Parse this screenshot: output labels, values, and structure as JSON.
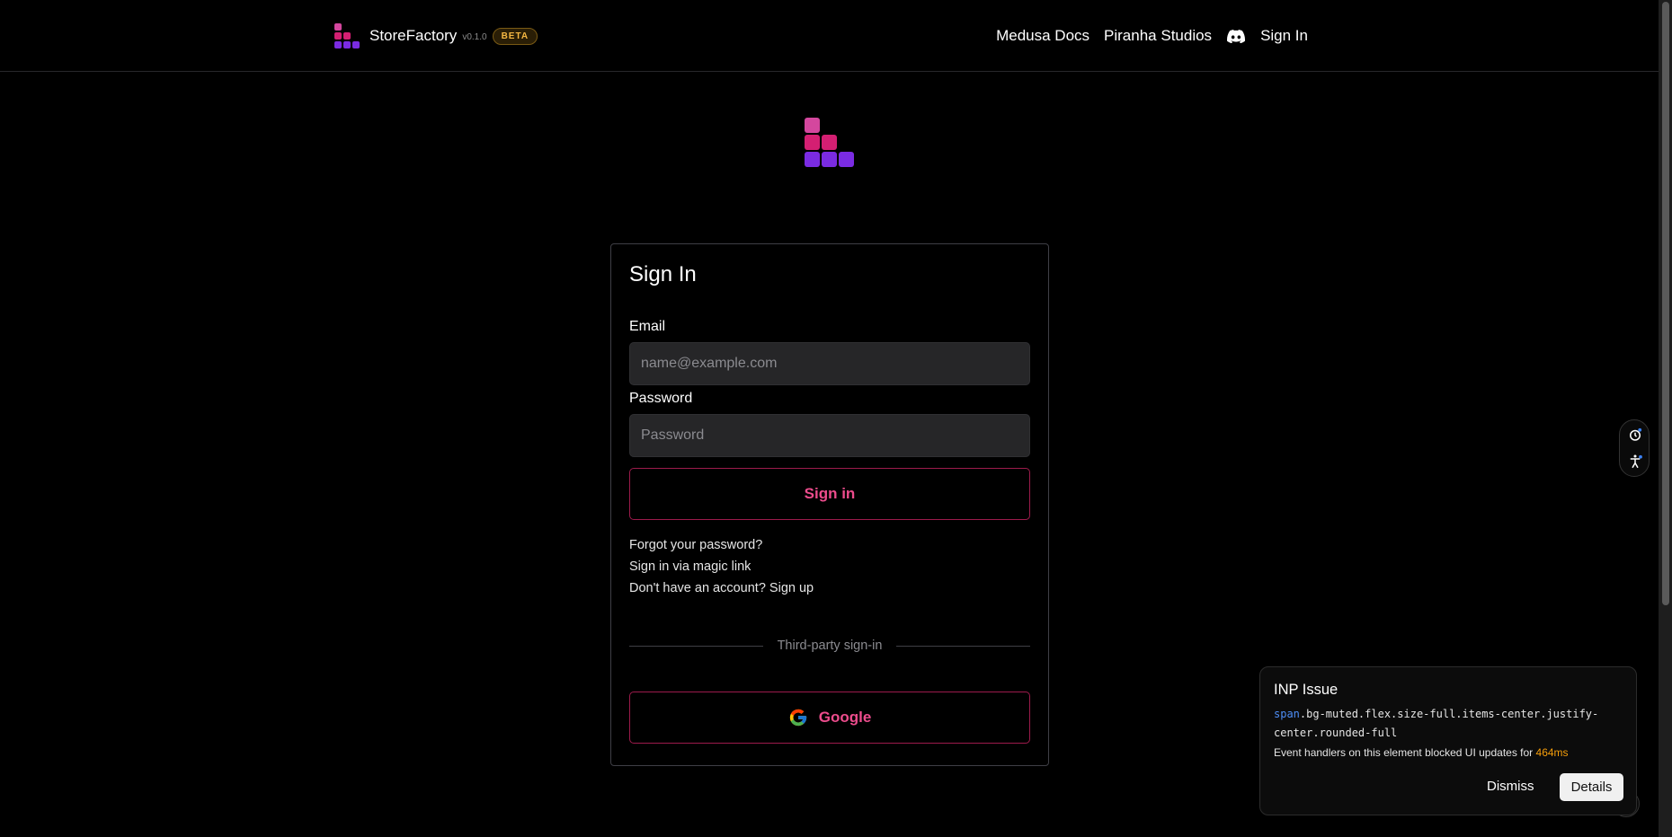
{
  "colors": {
    "background": "#000000",
    "accent": "#ec4c8c",
    "accent_border": "#9d1b4c",
    "badge": "#f5b742",
    "logo_pink": "#d4479e",
    "logo_magenta": "#d41f72",
    "logo_purple": "#7a2be2",
    "warning_value": "#f59e0b"
  },
  "header": {
    "brand_name": "StoreFactory",
    "version": "v0.1.0",
    "badge": "BETA",
    "nav": {
      "docs": "Medusa Docs",
      "studio": "Piranha Studios",
      "discord_icon": "discord-icon",
      "sign_in": "Sign In"
    }
  },
  "form": {
    "title": "Sign In",
    "email_label": "Email",
    "email_placeholder": "name@example.com",
    "email_value": "",
    "password_label": "Password",
    "password_placeholder": "Password",
    "password_value": "",
    "submit_label": "Sign in",
    "forgot_link": "Forgot your password?",
    "magic_link": "Sign in via magic link",
    "signup_link": "Don't have an account? Sign up",
    "divider_text": "Third-party sign-in",
    "google_label": "Google"
  },
  "toast": {
    "title": "INP Issue",
    "selector_tag": "span",
    "selector_classes": ".bg-muted.flex.size-full.items-center.justify-center.rounded-full",
    "message": "Event handlers on this element blocked UI updates for ",
    "duration": "464ms",
    "dismiss_label": "Dismiss",
    "details_label": "Details"
  }
}
